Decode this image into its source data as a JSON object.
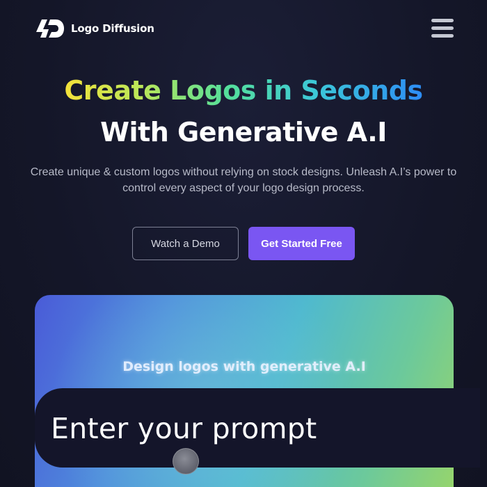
{
  "header": {
    "brand_name": "Logo Diffusion",
    "logo_icon": "ld-monogram-icon",
    "menu_icon": "hamburger-menu-icon"
  },
  "hero": {
    "headline_line1": "Create Logos in Seconds",
    "headline_line2": "With Generative A.I",
    "subheadline": "Create unique & custom logos without relying on stock designs. Unleash A.I’s power to control every aspect of your logo design process.",
    "buttons": {
      "demo_label": "Watch a Demo",
      "start_label": "Get Started Free"
    }
  },
  "demo": {
    "caption": "Design logos with generative A.I",
    "prompt_placeholder": "Enter your prompt",
    "cursor_icon": "pointer-cursor-icon"
  },
  "colors": {
    "background": "#141628",
    "accent_purple": "#7a56f2",
    "headline_gradient": [
      "#f4e23a",
      "#55e09a",
      "#3cc7d8",
      "#2d8cf5"
    ]
  }
}
